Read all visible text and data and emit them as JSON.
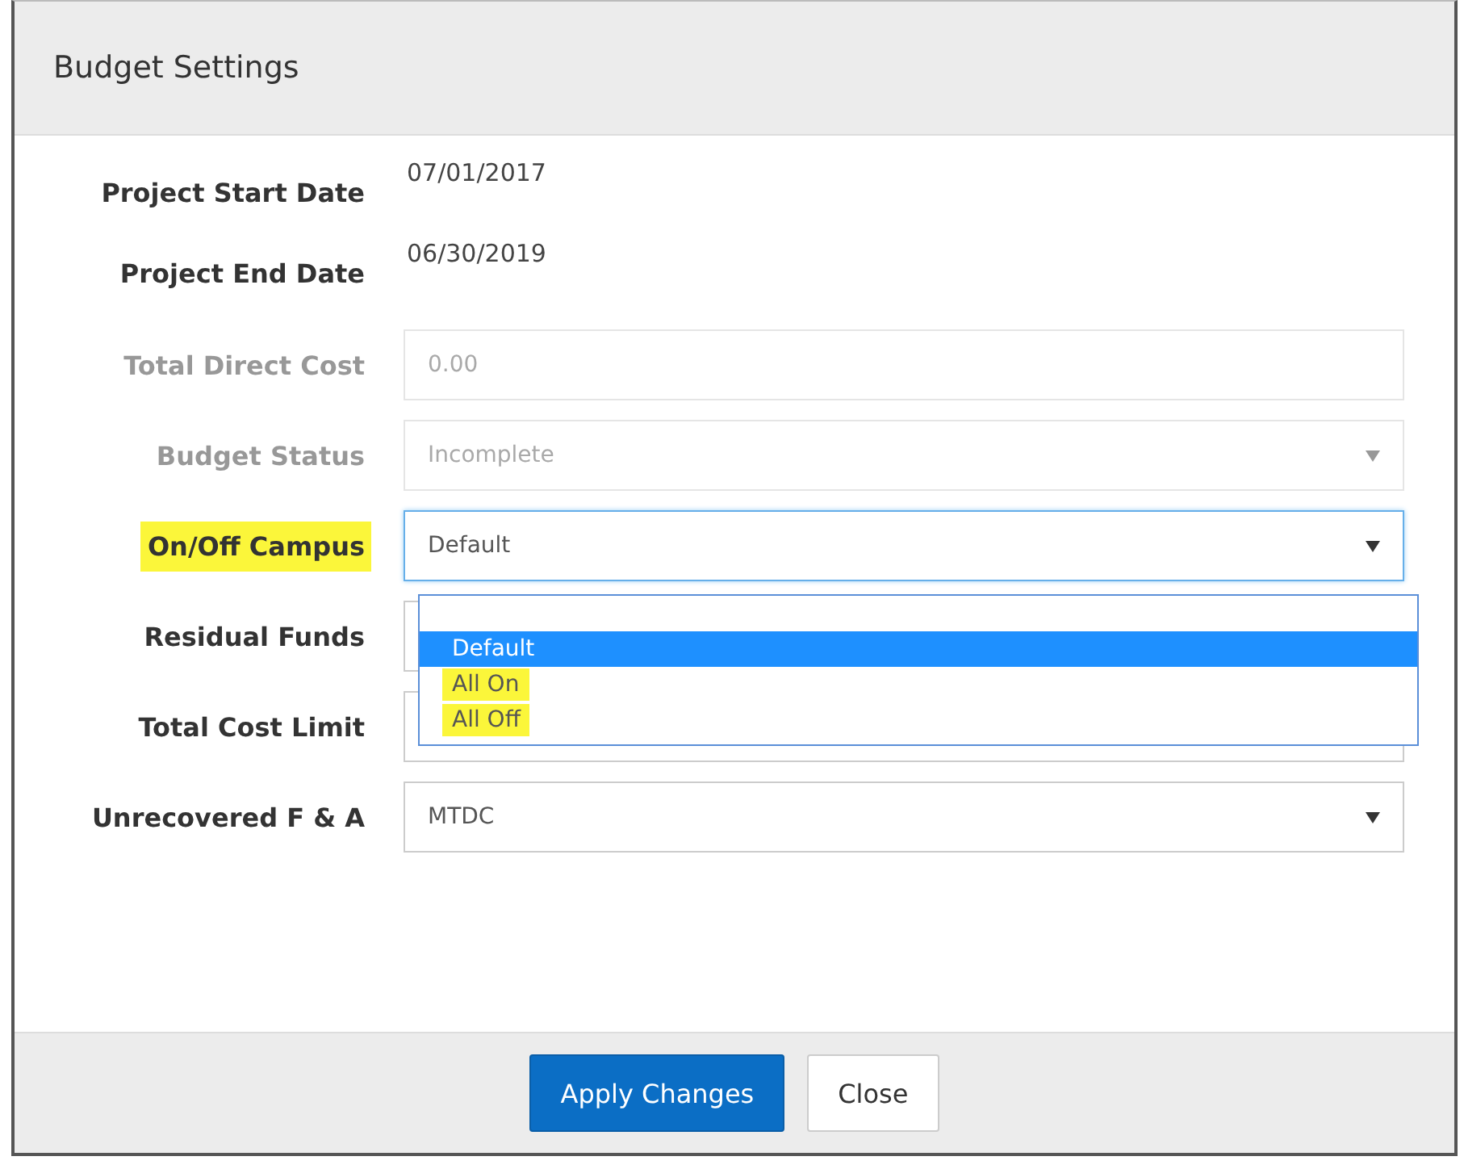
{
  "dialog": {
    "title": "Budget Settings"
  },
  "fields": [
    {
      "label": "Project Start Date",
      "kind": "text",
      "value": "07/01/2017",
      "faded": false,
      "highlighted": false
    },
    {
      "label": "Project End Date",
      "kind": "text",
      "value": "06/30/2019",
      "faded": false,
      "highlighted": false
    },
    {
      "label": "Total Direct Cost",
      "kind": "input",
      "value": "0.00",
      "faded": true,
      "highlighted": false
    },
    {
      "label": "Budget Status",
      "kind": "select",
      "value": "Incomplete",
      "faded": true,
      "highlighted": false
    },
    {
      "label": "On/Off Campus",
      "kind": "select",
      "value": "Default",
      "faded": false,
      "highlighted": true,
      "focused": true,
      "expanded": true,
      "options": [
        {
          "label": "Default",
          "selected": true,
          "highlighted": false
        },
        {
          "label": "All On",
          "selected": false,
          "highlighted": true
        },
        {
          "label": "All Off",
          "selected": false,
          "highlighted": true
        }
      ]
    },
    {
      "label": "Residual Funds",
      "kind": "input",
      "faded": false,
      "highlighted": false
    },
    {
      "label": "Total Cost Limit",
      "kind": "input",
      "faded": false,
      "highlighted": false
    },
    {
      "label": "Unrecovered F & A",
      "kind": "select",
      "value": "MTDC",
      "faded": false,
      "highlighted": false
    }
  ],
  "buttons": [
    {
      "label": "Apply Changes",
      "primary": true
    },
    {
      "label": "Close",
      "primary": false
    }
  ]
}
